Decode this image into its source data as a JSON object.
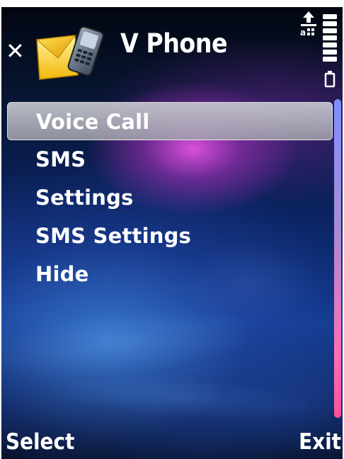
{
  "app": {
    "title": "V Phone"
  },
  "menu": {
    "items": [
      {
        "label": "Voice Call",
        "selected": true
      },
      {
        "label": "SMS",
        "selected": false
      },
      {
        "label": "Settings",
        "selected": false
      },
      {
        "label": "SMS Settings",
        "selected": false
      },
      {
        "label": "Hide",
        "selected": false
      }
    ]
  },
  "softkeys": {
    "left": "Select",
    "right": "Exit"
  },
  "status": {
    "icons": [
      "network-transfer-icon",
      "signal-strength-icon",
      "battery-icon"
    ]
  },
  "colors": {
    "text": "#ffffff",
    "selection": "#c8c8d0",
    "scroll_top": "#7f8fff",
    "scroll_bottom": "#ff4f9a"
  }
}
